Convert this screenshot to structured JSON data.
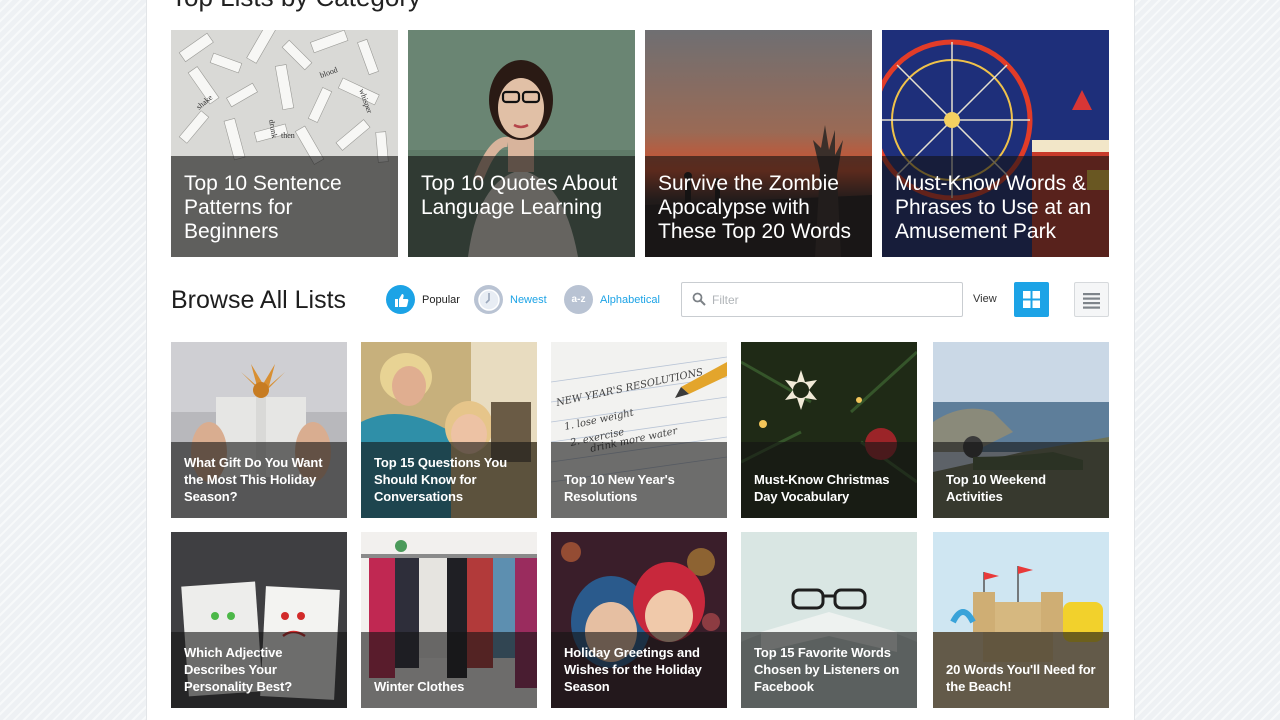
{
  "section_heading": "Top Lists by Category",
  "featured": [
    {
      "title": "Top 10 Sentence Patterns for Beginners"
    },
    {
      "title": "Top 10 Quotes About Language Learning"
    },
    {
      "title": "Survive the Zombie Apocalypse with These Top 20 Words"
    },
    {
      "title": "Must-Know Words & Phrases to Use at an Amusement Park"
    }
  ],
  "browse": {
    "title": "Browse All Lists",
    "sort": {
      "popular": "Popular",
      "newest": "Newest",
      "alpha_icon": "a-z",
      "alphabetical": "Alphabetical"
    },
    "filter_placeholder": "Filter",
    "view_label": "View"
  },
  "lists": [
    {
      "title": "What Gift Do You Want the Most This Holiday Season?"
    },
    {
      "title": "Top 15 Questions You Should Know for Conversations"
    },
    {
      "title": "Top 10 New Year's Resolutions"
    },
    {
      "title": "Must-Know Christmas Day Vocabulary"
    },
    {
      "title": "Top 10 Weekend Activities"
    },
    {
      "title": "Which Adjective Describes Your Personality Best?"
    },
    {
      "title": "Winter Clothes"
    },
    {
      "title": "Holiday Greetings and Wishes for the Holiday Season"
    },
    {
      "title": "Top 15 Favorite Words Chosen by Listeners on Facebook"
    },
    {
      "title": "20 Words You'll Need for the Beach!"
    }
  ],
  "colors": {
    "accent": "#1ca3e6",
    "inactive_sort": "#b9c3d3",
    "overlay": "rgba(20,20,20,0.6)"
  }
}
